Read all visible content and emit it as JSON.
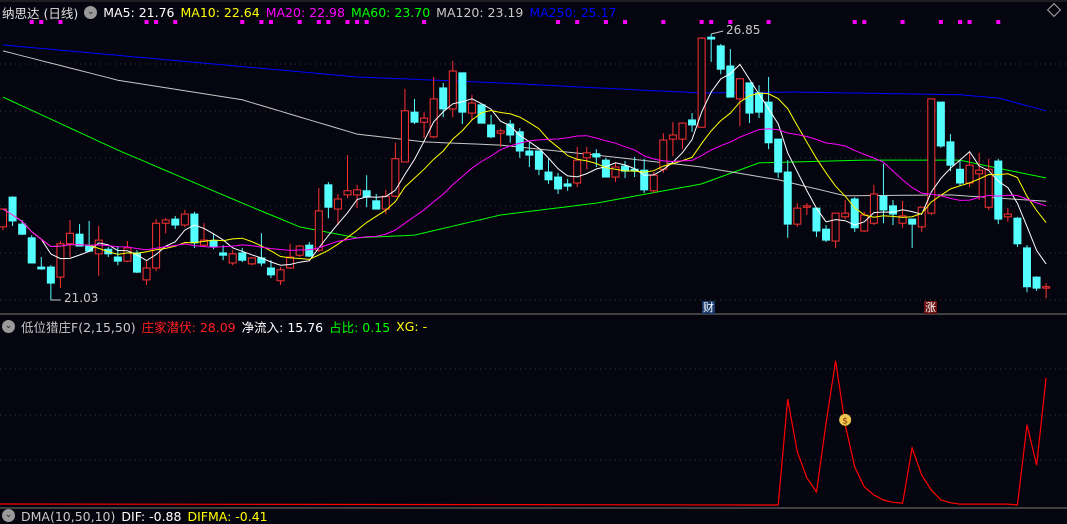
{
  "header": {
    "title": "纳思达 (日线)",
    "ma": [
      {
        "label": "MA5: 21.76",
        "color": "#ffffff"
      },
      {
        "label": "MA10: 22.64",
        "color": "#ffff00"
      },
      {
        "label": "MA20: 22.98",
        "color": "#ff00ff"
      },
      {
        "label": "MA60: 23.70",
        "color": "#00ff00"
      },
      {
        "label": "MA120: 23.19",
        "color": "#c8c8c8"
      },
      {
        "label": "MA250: 25.17",
        "color": "#0000ff"
      }
    ]
  },
  "indicator_header": {
    "name": "低位猎庄F(2,15,50)",
    "zhuang": "庄家潜伏: 28.09",
    "inflow": "净流入: 15.76",
    "ratio": "占比: 0.15",
    "xg": "XG: -"
  },
  "dma_header": {
    "name": "DMA(10,50,10)",
    "dif": "DIF: -0.88",
    "difma": "DIFMA: -0.41"
  },
  "annotations": {
    "high_label": "26.85",
    "low_label": "21.03",
    "tag_cai": "财",
    "tag_zhang": "涨"
  },
  "colors": {
    "up": "#ff3232",
    "down": "#54ffff",
    "background": "#05050f",
    "marker": "#ff00ff",
    "indicator": "#ff0000"
  },
  "chart_data": {
    "type": "candlestick",
    "title": "纳思达 (日线)",
    "high": 26.85,
    "high_index": 75,
    "low": 21.03,
    "low_index": 6,
    "candles_ohlc": [
      [
        22.63,
        23.02,
        22.56,
        23.02
      ],
      [
        23.28,
        23.3,
        22.65,
        22.76
      ],
      [
        22.69,
        22.78,
        22.45,
        22.47
      ],
      [
        22.39,
        22.45,
        21.84,
        21.84
      ],
      [
        21.75,
        21.97,
        21.69,
        21.71
      ],
      [
        21.75,
        21.79,
        21.03,
        21.4
      ],
      [
        21.53,
        22.32,
        21.29,
        22.26
      ],
      [
        22.26,
        22.78,
        21.97,
        22.49
      ],
      [
        22.47,
        22.69,
        22.21,
        22.21
      ],
      [
        22.21,
        22.76,
        22.08,
        22.1
      ],
      [
        22.04,
        22.65,
        21.56,
        22.34
      ],
      [
        22.14,
        22.19,
        21.97,
        22.04
      ],
      [
        21.97,
        22.21,
        21.79,
        21.88
      ],
      [
        21.88,
        22.32,
        21.86,
        22.17
      ],
      [
        22.06,
        22.12,
        21.62,
        21.64
      ],
      [
        21.47,
        21.9,
        21.36,
        21.73
      ],
      [
        21.73,
        22.8,
        21.66,
        22.71
      ],
      [
        22.71,
        22.82,
        22.49,
        22.78
      ],
      [
        22.8,
        22.87,
        22.58,
        22.67
      ],
      [
        22.67,
        23.0,
        22.63,
        22.91
      ],
      [
        22.91,
        22.96,
        22.17,
        22.28
      ],
      [
        22.23,
        22.71,
        22.19,
        22.34
      ],
      [
        22.32,
        22.47,
        22.14,
        22.19
      ],
      [
        22.06,
        22.23,
        21.9,
        22.01
      ],
      [
        21.84,
        22.12,
        21.79,
        22.04
      ],
      [
        22.06,
        22.17,
        21.86,
        21.9
      ],
      [
        21.82,
        21.97,
        21.79,
        21.95
      ],
      [
        21.95,
        22.49,
        21.77,
        21.84
      ],
      [
        21.73,
        21.9,
        21.51,
        21.58
      ],
      [
        21.45,
        21.75,
        21.36,
        21.69
      ],
      [
        21.73,
        22.26,
        21.71,
        21.97
      ],
      [
        22.01,
        22.23,
        21.97,
        22.21
      ],
      [
        22.23,
        22.3,
        21.97,
        21.99
      ],
      [
        22.12,
        23.48,
        22.08,
        22.98
      ],
      [
        23.55,
        23.61,
        22.82,
        23.06
      ],
      [
        23.02,
        23.35,
        22.67,
        23.24
      ],
      [
        23.33,
        24.2,
        23.26,
        23.42
      ],
      [
        23.33,
        23.55,
        23.04,
        23.44
      ],
      [
        23.42,
        23.76,
        23.06,
        23.28
      ],
      [
        23.2,
        23.35,
        23.02,
        23.02
      ],
      [
        23.02,
        23.44,
        22.91,
        23.3
      ],
      [
        23.3,
        24.47,
        23.28,
        24.12
      ],
      [
        24.05,
        25.65,
        24.05,
        25.17
      ],
      [
        25.14,
        25.43,
        24.88,
        24.92
      ],
      [
        24.92,
        25.14,
        24.57,
        25.01
      ],
      [
        24.6,
        25.91,
        24.57,
        25.43
      ],
      [
        25.67,
        25.78,
        25.03,
        25.21
      ],
      [
        25.21,
        26.26,
        25.03,
        26.04
      ],
      [
        26.0,
        26.0,
        24.88,
        25.14
      ],
      [
        25.12,
        25.52,
        24.97,
        25.34
      ],
      [
        25.3,
        25.3,
        24.9,
        24.9
      ],
      [
        24.86,
        25.08,
        24.57,
        24.6
      ],
      [
        24.68,
        24.77,
        24.38,
        24.73
      ],
      [
        24.88,
        24.97,
        24.47,
        24.64
      ],
      [
        24.71,
        24.79,
        24.14,
        24.29
      ],
      [
        24.29,
        24.47,
        23.94,
        24.2
      ],
      [
        24.29,
        24.29,
        23.76,
        23.89
      ],
      [
        23.83,
        24.12,
        23.57,
        23.66
      ],
      [
        23.72,
        23.81,
        23.35,
        23.46
      ],
      [
        23.57,
        23.68,
        23.42,
        23.52
      ],
      [
        23.59,
        24.38,
        23.5,
        24.09
      ],
      [
        24.14,
        24.38,
        23.89,
        24.25
      ],
      [
        24.23,
        24.33,
        23.94,
        24.16
      ],
      [
        24.09,
        24.14,
        23.72,
        23.72
      ],
      [
        23.72,
        24.03,
        23.61,
        23.94
      ],
      [
        23.96,
        24.07,
        23.7,
        23.85
      ],
      [
        23.89,
        24.16,
        23.72,
        23.85
      ],
      [
        23.87,
        24.12,
        23.37,
        23.44
      ],
      [
        23.42,
        23.83,
        23.37,
        23.76
      ],
      [
        23.89,
        24.68,
        23.81,
        24.53
      ],
      [
        24.55,
        24.92,
        24.18,
        24.64
      ],
      [
        24.55,
        24.92,
        24.33,
        24.9
      ],
      [
        24.97,
        25.12,
        24.71,
        24.86
      ],
      [
        24.81,
        26.78,
        24.81,
        26.76
      ],
      [
        26.78,
        26.85,
        26.24,
        26.74
      ],
      [
        26.59,
        26.63,
        25.97,
        26.08
      ],
      [
        26.15,
        26.52,
        25.47,
        25.47
      ],
      [
        25.43,
        25.87,
        24.84,
        25.87
      ],
      [
        25.78,
        25.78,
        24.9,
        25.12
      ],
      [
        25.56,
        25.73,
        25.01,
        25.14
      ],
      [
        25.36,
        25.91,
        24.33,
        24.47
      ],
      [
        24.55,
        24.55,
        23.7,
        23.83
      ],
      [
        23.83,
        24.09,
        22.39,
        22.69
      ],
      [
        22.69,
        23.15,
        22.63,
        23.04
      ],
      [
        23.06,
        23.15,
        22.89,
        23.09
      ],
      [
        23.04,
        23.04,
        22.41,
        22.54
      ],
      [
        22.58,
        22.67,
        22.3,
        22.34
      ],
      [
        22.32,
        22.93,
        22.17,
        22.93
      ],
      [
        22.85,
        23.22,
        22.8,
        22.93
      ],
      [
        23.24,
        23.28,
        22.52,
        22.61
      ],
      [
        22.54,
        22.96,
        22.52,
        22.89
      ],
      [
        22.71,
        23.55,
        22.67,
        23.35
      ],
      [
        23.3,
        24.01,
        22.71,
        23.0
      ],
      [
        23.09,
        23.22,
        22.67,
        22.91
      ],
      [
        22.71,
        23.2,
        22.61,
        22.87
      ],
      [
        22.8,
        22.8,
        22.17,
        22.69
      ],
      [
        22.63,
        23.06,
        22.52,
        23.06
      ],
      [
        22.93,
        25.43,
        22.89,
        25.43
      ],
      [
        25.36,
        25.36,
        24.36,
        24.4
      ],
      [
        24.49,
        24.66,
        23.85,
        23.98
      ],
      [
        23.89,
        24.09,
        23.52,
        23.59
      ],
      [
        23.59,
        24.27,
        23.5,
        23.98
      ],
      [
        23.79,
        24.25,
        23.22,
        23.87
      ],
      [
        23.06,
        24.12,
        23.0,
        23.89
      ],
      [
        24.07,
        24.12,
        22.69,
        22.8
      ],
      [
        22.85,
        23.04,
        22.74,
        22.91
      ],
      [
        22.82,
        22.85,
        22.19,
        22.26
      ],
      [
        22.17,
        22.23,
        21.2,
        21.32
      ],
      [
        21.53,
        21.55,
        21.23,
        21.29
      ],
      [
        21.29,
        21.4,
        21.07,
        21.32
      ]
    ],
    "ma_computed": [
      {
        "name": "MA5",
        "period": 5,
        "color": "#ffffff"
      },
      {
        "name": "MA10",
        "period": 10,
        "color": "#ffff00"
      },
      {
        "name": "MA20",
        "period": 20,
        "color": "#ff00ff"
      }
    ],
    "ma_anchors": [
      {
        "name": "MA60",
        "color": "#00ff00",
        "points": [
          [
            1,
            25.47
          ],
          [
            13,
            24.31
          ],
          [
            26,
            23.15
          ],
          [
            32,
            22.63
          ],
          [
            38,
            22.39
          ],
          [
            44,
            22.45
          ],
          [
            53,
            22.89
          ],
          [
            63,
            23.15
          ],
          [
            74,
            23.57
          ],
          [
            80,
            24.03
          ],
          [
            91,
            24.09
          ],
          [
            101,
            24.09
          ],
          [
            106,
            23.87
          ],
          [
            110,
            23.7
          ]
        ]
      },
      {
        "name": "MA120",
        "color": "#c8c8c8",
        "points": [
          [
            1,
            26.48
          ],
          [
            13,
            25.84
          ],
          [
            26,
            25.41
          ],
          [
            38,
            24.66
          ],
          [
            45,
            24.49
          ],
          [
            53,
            24.42
          ],
          [
            63,
            24.2
          ],
          [
            74,
            23.94
          ],
          [
            82,
            23.66
          ],
          [
            89,
            23.31
          ],
          [
            100,
            23.33
          ],
          [
            110,
            23.19
          ]
        ]
      },
      {
        "name": "MA250",
        "color": "#0000ff",
        "points": [
          [
            1,
            26.61
          ],
          [
            38,
            25.91
          ],
          [
            53,
            25.78
          ],
          [
            65,
            25.65
          ],
          [
            74,
            25.56
          ],
          [
            84,
            25.58
          ],
          [
            101,
            25.52
          ],
          [
            105,
            25.45
          ],
          [
            110,
            25.17
          ]
        ]
      }
    ],
    "signal_markers_candle_index": [
      4,
      5,
      7,
      16,
      17,
      19,
      26,
      28,
      29,
      32,
      34,
      35,
      37,
      38,
      39,
      45,
      59,
      61,
      64,
      66,
      70,
      74,
      75,
      77,
      81,
      90,
      91,
      95,
      99,
      101,
      102,
      105
    ],
    "tag_cai_index": 74,
    "tag_zhang_index": 98,
    "indicator": {
      "name": "庄家潜伏",
      "type": "line",
      "ylim": [
        0,
        40
      ],
      "values_from_index_82": [
        0,
        23.4,
        11.7,
        6,
        2.9,
        18,
        31.8,
        17.7,
        8.4,
        4,
        2.2,
        1.1,
        0.6,
        0.4,
        12.6,
        6.6,
        3.3,
        1.1,
        0.5,
        0.2,
        0.2,
        0.2,
        0.2,
        0.2,
        0.2,
        0,
        17.7,
        8.8,
        28.09
      ],
      "icon_index": 89
    }
  }
}
